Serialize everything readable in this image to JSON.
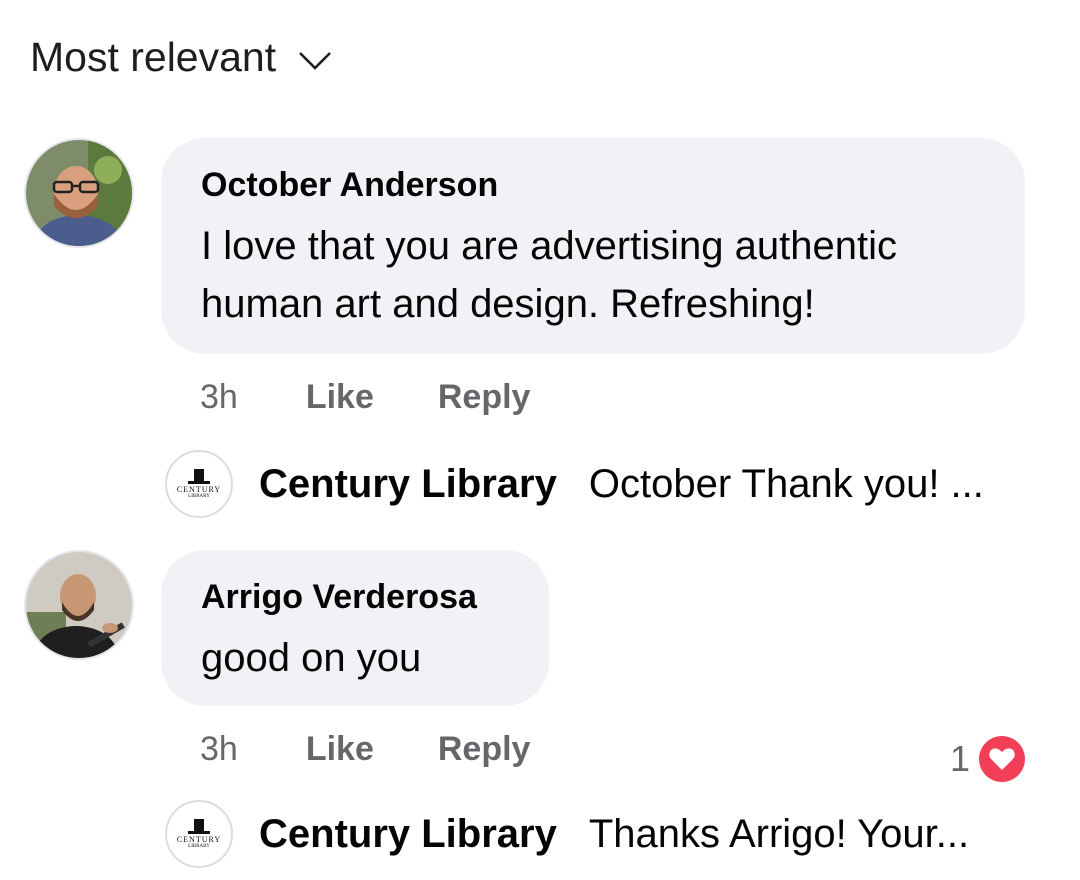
{
  "sort": {
    "label": "Most relevant"
  },
  "comments": [
    {
      "author": "October Anderson",
      "text_lines": [
        "I love that you are advertising authentic",
        "human art and design. Refreshing!"
      ],
      "time": "3h",
      "like_label": "Like",
      "reply_label": "Reply",
      "reply_preview": {
        "author": "Century Library",
        "text": "October Thank you! ..."
      }
    },
    {
      "author": "Arrigo Verderosa",
      "text": "good on you",
      "time": "3h",
      "like_label": "Like",
      "reply_label": "Reply",
      "reaction": {
        "count": "1",
        "icon": "heart-icon",
        "color": "#f33e58"
      },
      "reply_preview": {
        "author": "Century Library",
        "text": "Thanks Arrigo! Your..."
      }
    }
  ],
  "page_logo": {
    "word": "CENTURY",
    "sub": "LIBRARY",
    "icon": "top-hat-icon"
  },
  "colors": {
    "bubble": "#f0f2f5",
    "muted": "#65676b",
    "text": "#050505",
    "heart": "#f33e58"
  }
}
